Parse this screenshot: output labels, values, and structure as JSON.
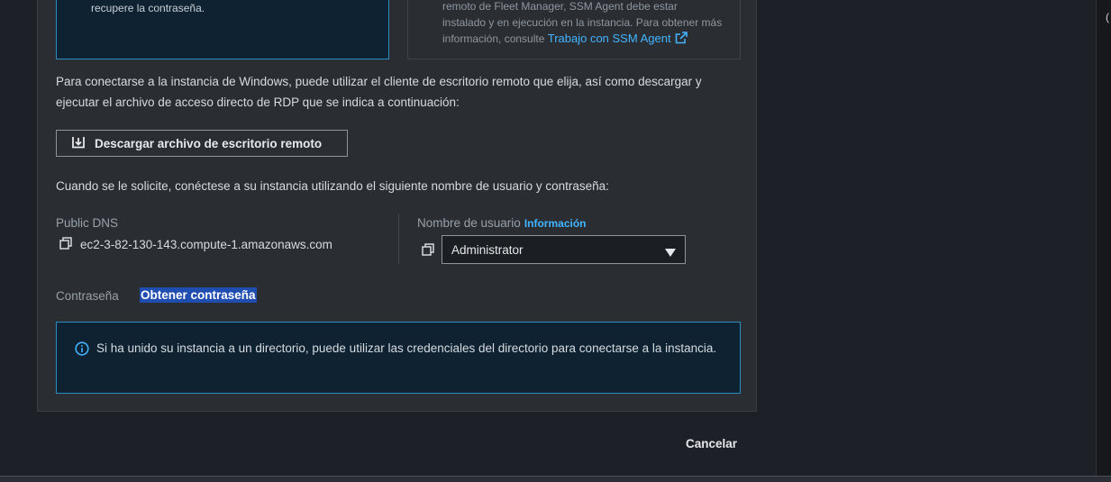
{
  "top_left_box": {
    "text": "recupere la contraseña."
  },
  "top_right_box": {
    "line1": "remoto de Fleet Manager, SSM Agent debe estar",
    "line2": "instalado y en ejecución en la instancia. Para obtener más",
    "line3_prefix": "información, consulte ",
    "link_text": "Trabajo con SSM Agent"
  },
  "intro_paragraph": "Para conectarse a la instancia de Windows, puede utilizar el cliente de escritorio remoto que elija, así como descargar y ejecutar el archivo de acceso directo de RDP que se indica a continuación:",
  "download_button_label": "Descargar archivo de escritorio remoto",
  "prompt_paragraph": "Cuando se le solicite, conéctese a su instancia utilizando el siguiente nombre de usuario y contraseña:",
  "public_dns": {
    "label": "Public DNS",
    "value": "ec2-3-82-130-143.compute-1.amazonaws.com"
  },
  "username": {
    "label": "Nombre de usuario",
    "info_link": "Información",
    "selected": "Administrator"
  },
  "password": {
    "label": "Contraseña",
    "link": "Obtener contraseña"
  },
  "alert_text": "Si ha unido su instancia a un directorio, puede utilizar las credenciales del directorio para conectarse a la instancia.",
  "cancel_label": "Cancelar",
  "colors": {
    "accent_link": "#42b4ff",
    "info_border": "#2a8ec3",
    "panel_bg": "#2a2e33",
    "page_bg": "#1d2026"
  },
  "icons": [
    "external-link-icon",
    "download-icon",
    "copy-icon",
    "caret-down-icon",
    "info-icon"
  ]
}
